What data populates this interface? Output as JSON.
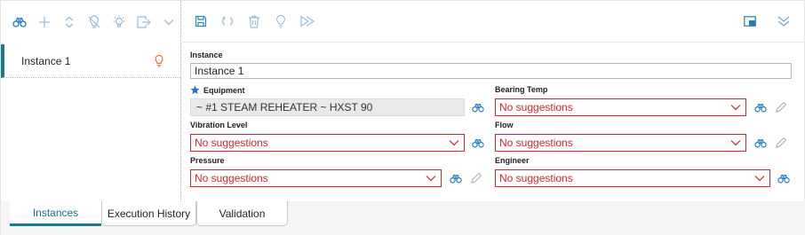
{
  "left_toolbar": {
    "icons": [
      "binoculars-icon",
      "plus-icon",
      "move-up-down-icon",
      "no-bulb-icon",
      "bulb-settings-icon",
      "export-icon",
      "chevron-down-icon"
    ]
  },
  "instances": [
    {
      "label": "Instance 1",
      "status_icon": "bulb-icon"
    }
  ],
  "right_toolbar": {
    "icons": [
      "save-icon",
      "undo-icon",
      "delete-icon",
      "bulb-icon",
      "run-icon",
      "maximize-icon",
      "collapse-icon"
    ]
  },
  "form": {
    "instance": {
      "label": "Instance",
      "value": "Instance 1"
    },
    "equipment": {
      "label": "Equipment",
      "value": "~ #1 STEAM REHEATER ~ HXST 90",
      "required_icon": "star-icon"
    },
    "bearing_temp": {
      "label": "Bearing Temp",
      "value": "No suggestions"
    },
    "vibration_level": {
      "label": "Vibration Level",
      "value": "No suggestions"
    },
    "flow": {
      "label": "Flow",
      "value": "No suggestions"
    },
    "pressure": {
      "label": "Pressure",
      "value": "No suggestions"
    },
    "engineer": {
      "label": "Engineer",
      "value": "No suggestions"
    }
  },
  "tabs": [
    {
      "label": "Instances",
      "active": true
    },
    {
      "label": "Execution History",
      "active": false
    },
    {
      "label": "Validation",
      "active": false
    }
  ],
  "colors": {
    "accent": "#1a7a8f",
    "icon_blue": "#1f7bbf",
    "error": "#d6252b",
    "bulb": "#e8683a",
    "star": "#2d6fd6"
  }
}
